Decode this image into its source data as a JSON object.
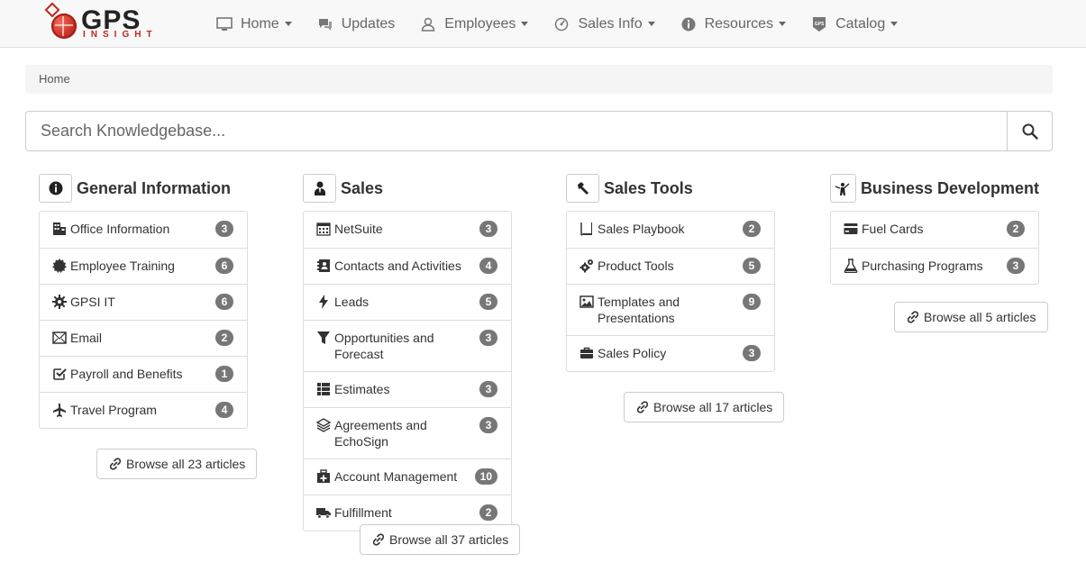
{
  "app": {
    "logo_text": "GPS",
    "logo_sub": "INSIGHT"
  },
  "nav": [
    {
      "label": "Home",
      "icon": "monitor-icon",
      "dropdown": true
    },
    {
      "label": "Updates",
      "icon": "comments-icon",
      "dropdown": false
    },
    {
      "label": "Employees",
      "icon": "user-icon",
      "dropdown": true
    },
    {
      "label": "Sales Info",
      "icon": "gauge-icon",
      "dropdown": true
    },
    {
      "label": "Resources",
      "icon": "info-circle-icon",
      "dropdown": true
    },
    {
      "label": "Catalog",
      "icon": "gps-badge-icon",
      "dropdown": true
    }
  ],
  "breadcrumb": {
    "current": "Home"
  },
  "search": {
    "placeholder": "Search Knowledgebase..."
  },
  "columns": [
    {
      "title": "General Information",
      "icon": "info-circle-icon",
      "items": [
        {
          "label": "Office Information",
          "count": "3",
          "icon": "building-icon"
        },
        {
          "label": "Employee Training",
          "count": "6",
          "icon": "certificate-icon"
        },
        {
          "label": "GPSI IT",
          "count": "6",
          "icon": "cog-icon"
        },
        {
          "label": "Email",
          "count": "2",
          "icon": "envelope-icon"
        },
        {
          "label": "Payroll and Benefits",
          "count": "1",
          "icon": "check-square-icon"
        },
        {
          "label": "Travel Program",
          "count": "4",
          "icon": "plane-icon"
        }
      ],
      "browse_label": "Browse all 23 articles"
    },
    {
      "title": "Sales",
      "icon": "user-tie-icon",
      "items": [
        {
          "label": "NetSuite",
          "count": "3",
          "icon": "calendar-icon"
        },
        {
          "label": "Contacts and Activities",
          "count": "4",
          "icon": "contact-book-icon"
        },
        {
          "label": "Leads",
          "count": "5",
          "icon": "flash-icon"
        },
        {
          "label": "Opportunities and Forecast",
          "count": "3",
          "icon": "filter-icon"
        },
        {
          "label": "Estimates",
          "count": "3",
          "icon": "list-table-icon"
        },
        {
          "label": "Agreements and EchoSign",
          "count": "3",
          "icon": "layers-icon"
        },
        {
          "label": "Account Management",
          "count": "10",
          "icon": "medkit-icon"
        },
        {
          "label": "Fulfillment",
          "count": "2",
          "icon": "truck-icon"
        }
      ],
      "browse_label": "Browse all 37 articles"
    },
    {
      "title": "Sales Tools",
      "icon": "hammer-icon",
      "items": [
        {
          "label": "Sales Playbook",
          "count": "2",
          "icon": "book-icon"
        },
        {
          "label": "Product Tools",
          "count": "5",
          "icon": "cogs-icon"
        },
        {
          "label": "Templates and Presentations",
          "count": "9",
          "icon": "picture-icon"
        },
        {
          "label": "Sales Policy",
          "count": "3",
          "icon": "briefcase-icon"
        }
      ],
      "browse_label": "Browse all 17 articles"
    },
    {
      "title": "Business Development",
      "icon": "presenter-icon",
      "items": [
        {
          "label": "Fuel Cards",
          "count": "2",
          "icon": "credit-card-icon"
        },
        {
          "label": "Purchasing Programs",
          "count": "3",
          "icon": "flask-icon"
        }
      ],
      "browse_label": "Browse all 5 articles"
    }
  ]
}
